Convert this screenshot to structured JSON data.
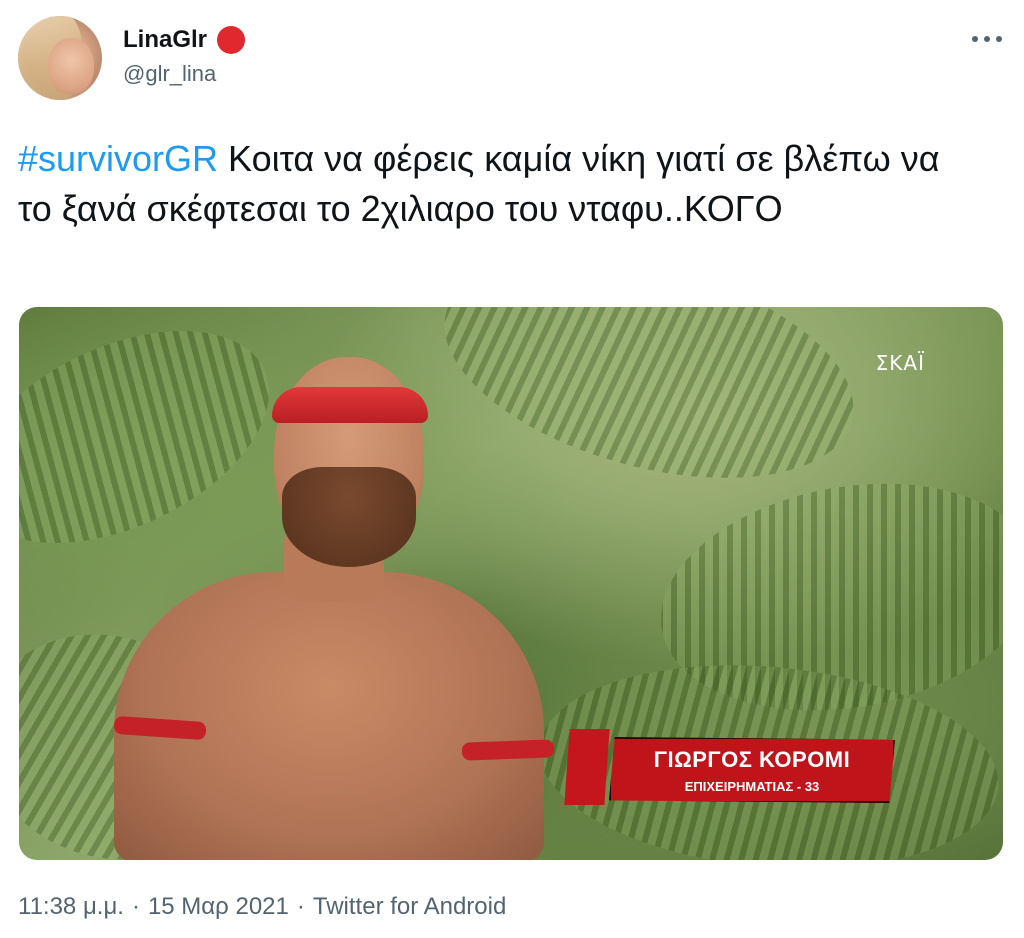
{
  "author": {
    "display_name": "LinaGlr",
    "handle": "@glr_lina",
    "badge_color": "#e0282e",
    "avatar_icon": "profile-photo"
  },
  "tweet": {
    "hashtag": "#survivorGR",
    "text": " Κοιτα να φέρεις καμία νίκη γιατί σε βλέπω να το ξανά σκέφτεσαι το 2χιλιαρο του νταφυ..ΚΟΓΟ"
  },
  "media": {
    "watermark": "ΣΚΑΪ",
    "lower_third": {
      "name": "ΓΙΩΡΓΟΣ ΚΟΡΟΜΙ",
      "subtitle": "ΕΠΙΧΕΙΡΗΜΑΤΙΑΣ - 33"
    }
  },
  "meta": {
    "time": "11:38 μ.μ.",
    "date": "15 Μαρ 2021",
    "source": "Twitter for Android",
    "separator": "·"
  },
  "colors": {
    "link": "#1d9bf0",
    "secondary_text": "#536471",
    "primary_text": "#0f1419"
  },
  "icons": {
    "more": "more-horizontal-icon"
  }
}
